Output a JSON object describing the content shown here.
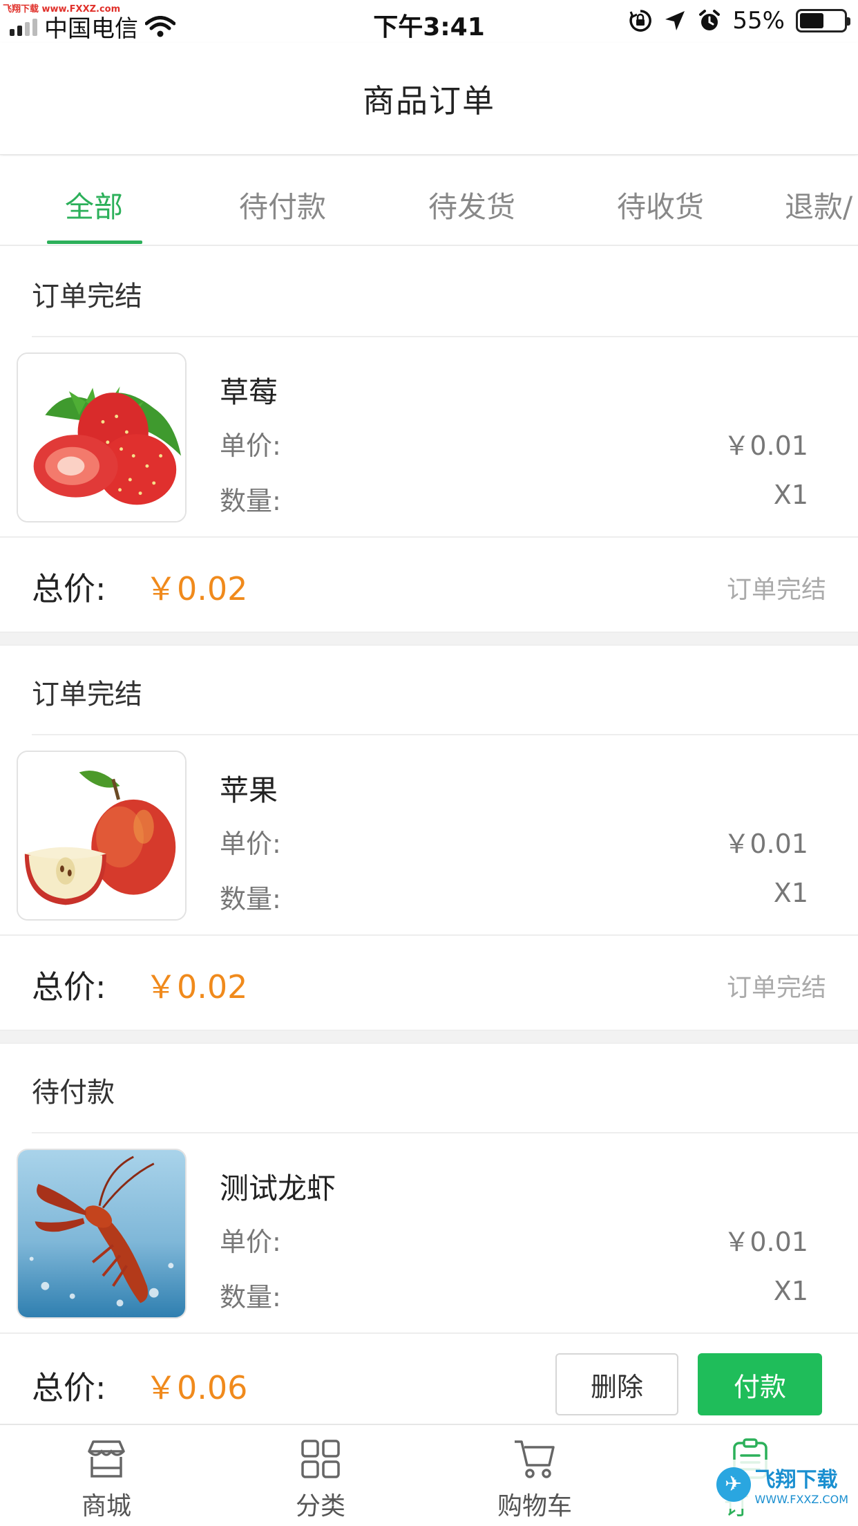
{
  "status_bar": {
    "watermark": "飞翔下载 www.FXXZ.com",
    "carrier": "中国电信",
    "time": "下午3:41",
    "battery_percent": "55%",
    "battery_level": 0.55
  },
  "header": {
    "title": "商品订单"
  },
  "tabs": [
    {
      "label": "全部",
      "active": true
    },
    {
      "label": "待付款",
      "active": false
    },
    {
      "label": "待发货",
      "active": false
    },
    {
      "label": "待收货",
      "active": false
    },
    {
      "label": "退款/",
      "active": false
    }
  ],
  "orders": [
    {
      "status": "订单完结",
      "product": {
        "name": "草莓",
        "image": "strawberry"
      },
      "unit_price_label": "单价:",
      "unit_price": "￥0.01",
      "quantity_label": "数量:",
      "quantity": "X1",
      "total_label": "总价:",
      "total": "￥0.02",
      "state_text": "订单完结"
    },
    {
      "status": "订单完结",
      "product": {
        "name": "苹果",
        "image": "apple"
      },
      "unit_price_label": "单价:",
      "unit_price": "￥0.01",
      "quantity_label": "数量:",
      "quantity": "X1",
      "total_label": "总价:",
      "total": "￥0.02",
      "state_text": "订单完结"
    },
    {
      "status": "待付款",
      "product": {
        "name": "测试龙虾",
        "image": "lobster"
      },
      "unit_price_label": "单价:",
      "unit_price": "￥0.01",
      "quantity_label": "数量:",
      "quantity": "X1",
      "total_label": "总价:",
      "total": "￥0.06",
      "actions": {
        "delete": "删除",
        "pay": "付款"
      }
    }
  ],
  "tabbar": {
    "items": [
      {
        "label": "商城",
        "icon": "store-icon"
      },
      {
        "label": "分类",
        "icon": "grid-icon"
      },
      {
        "label": "购物车",
        "icon": "cart-icon"
      },
      {
        "label": "订",
        "icon": "order-icon",
        "active": true
      }
    ],
    "watermark_main": "飞翔下载",
    "watermark_url": "WWW.FXXZ.COM"
  },
  "colors": {
    "accent_green": "#2cb05a",
    "pay_button": "#1fbd5a",
    "price_orange": "#f08a1c"
  }
}
